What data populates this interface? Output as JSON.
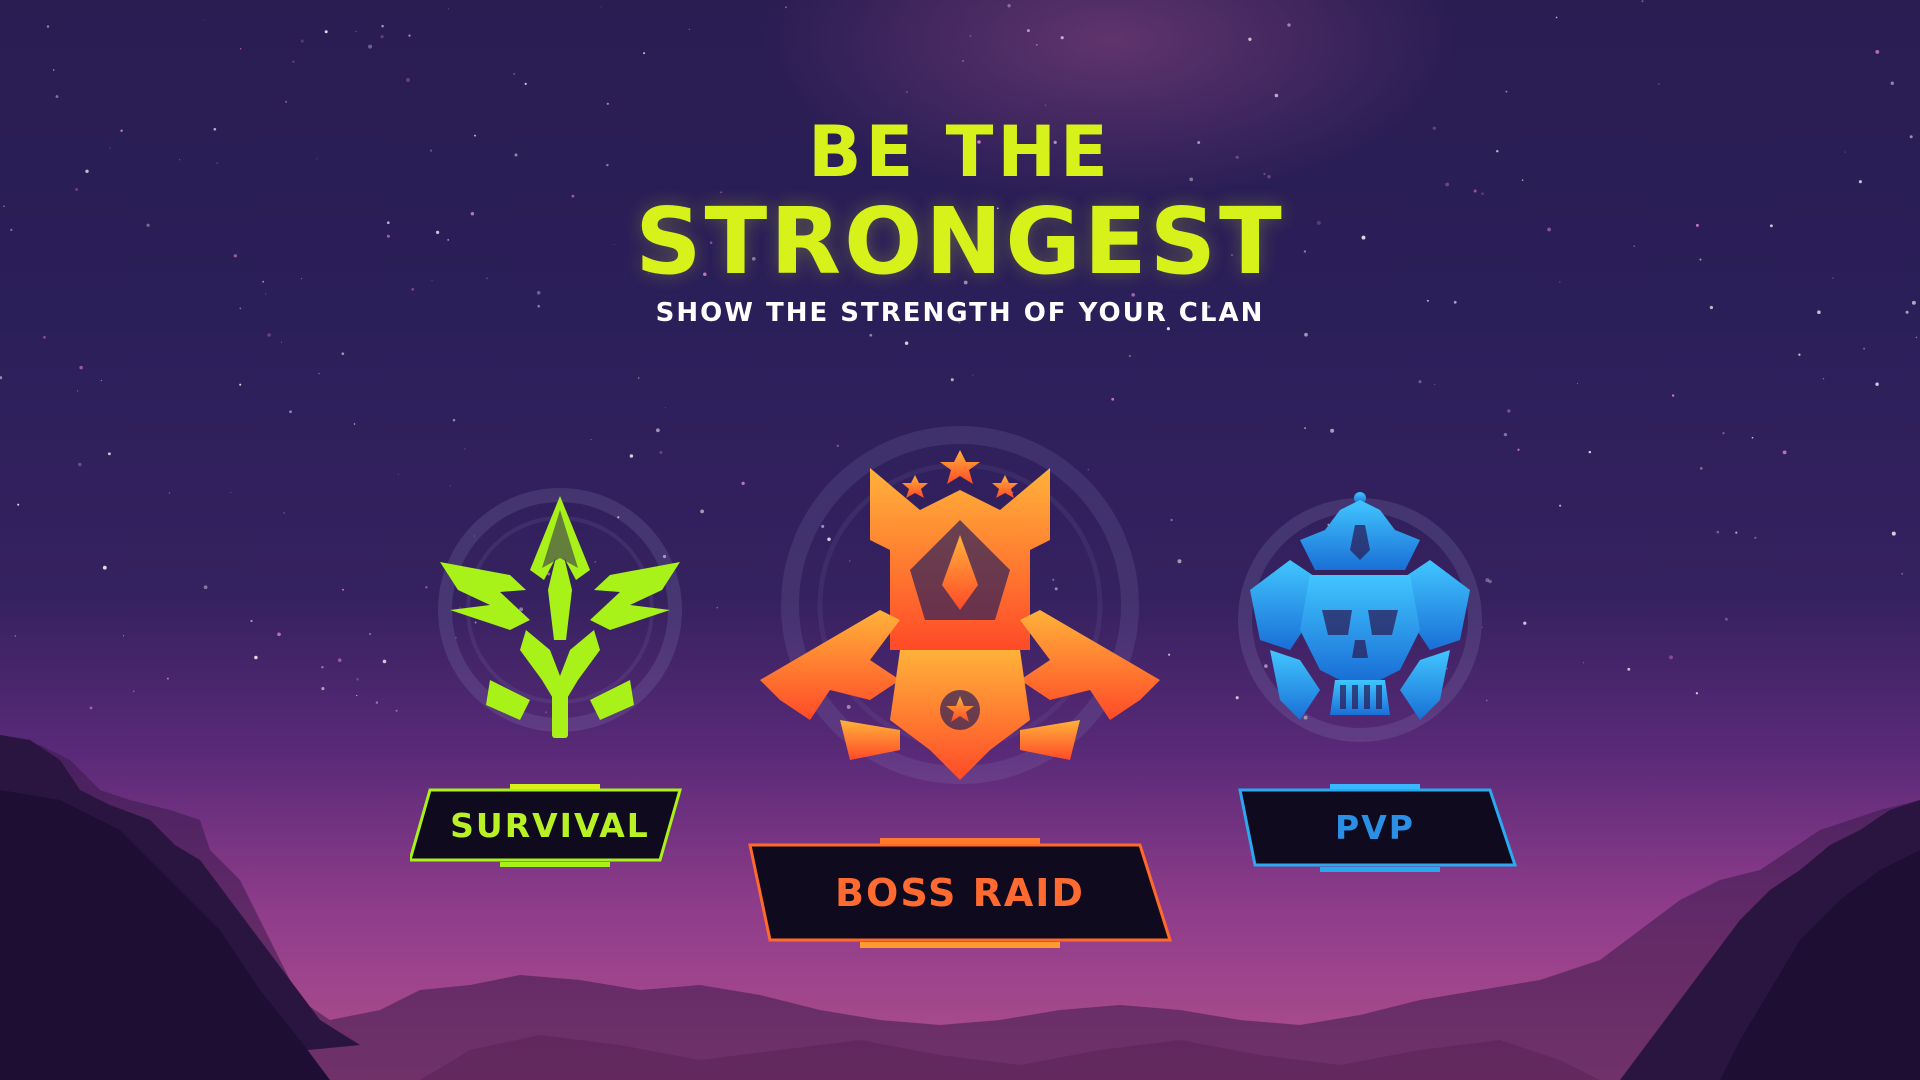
{
  "header": {
    "title_line1": "BE THE",
    "title_line2": "STRONGEST",
    "subtitle": "SHOW THE STRENGTH OF YOUR CLAN"
  },
  "modes": [
    {
      "label": "SURVIVAL",
      "icon": "leaf-sword-emblem-icon",
      "color": "#a8f21a"
    },
    {
      "label": "BOSS RAID",
      "icon": "crown-guns-emblem-icon",
      "color": "#ff6a2b"
    },
    {
      "label": "PVP",
      "icon": "crowned-skull-emblem-icon",
      "color": "#2aa8f0"
    }
  ],
  "colors": {
    "title": "#d6f21a",
    "subtitle": "#ffffff",
    "sky_top": "#2a1d52",
    "sky_bottom": "#b24f8e"
  }
}
